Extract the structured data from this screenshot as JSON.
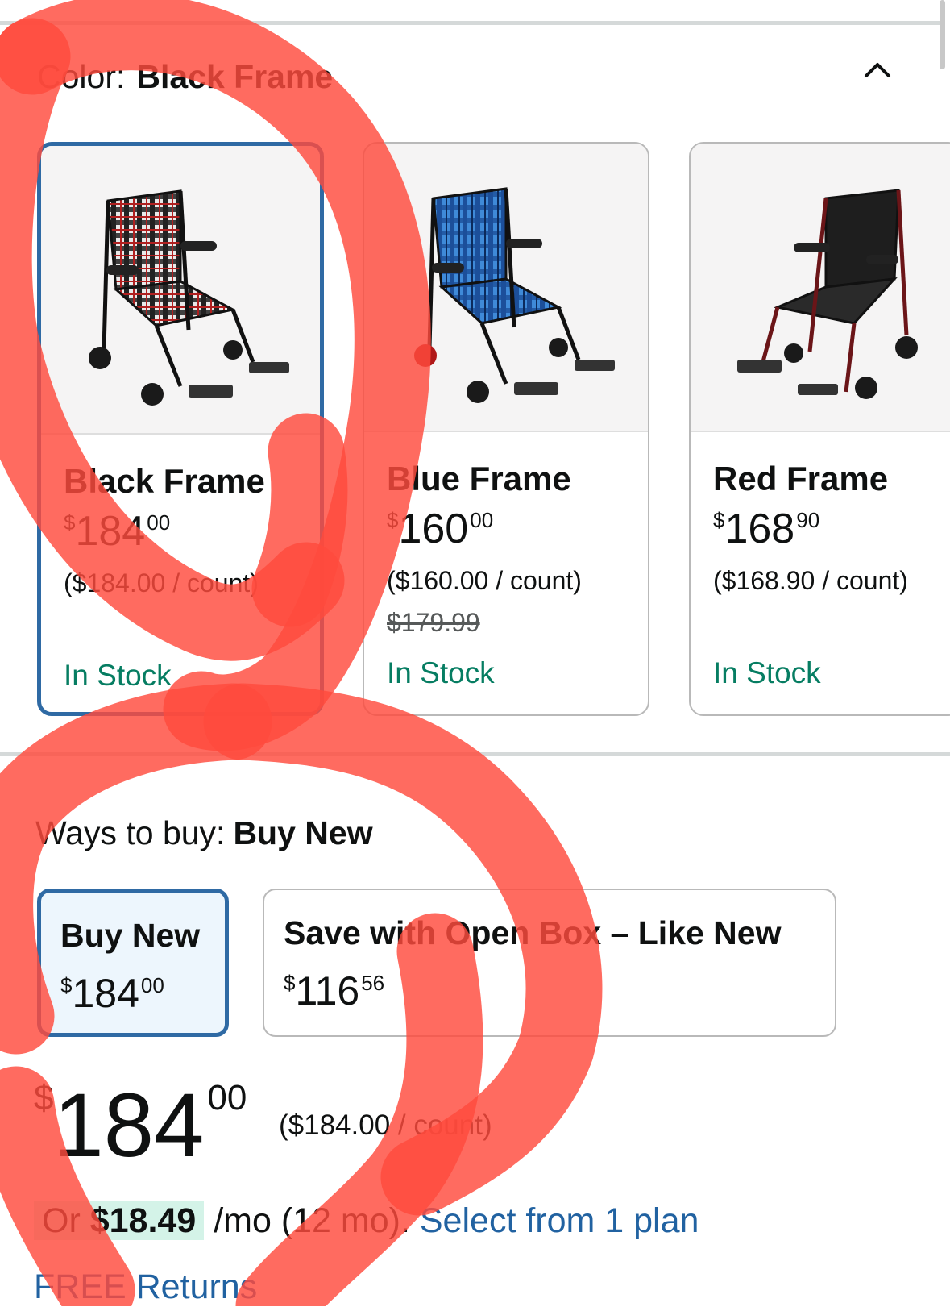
{
  "color": {
    "label": "Color:",
    "value": "Black Frame"
  },
  "variants": [
    {
      "name": "Black Frame",
      "price_symbol": "$",
      "price_whole": "184",
      "price_fraction": "00",
      "unit_price": "($184.00 / count)",
      "list_price": "",
      "stock": "In Stock",
      "selected": true
    },
    {
      "name": "Blue Frame",
      "price_symbol": "$",
      "price_whole": "160",
      "price_fraction": "00",
      "unit_price": "($160.00 / count)",
      "list_price": "$179.99",
      "stock": "In Stock",
      "selected": false
    },
    {
      "name": "Red Frame",
      "price_symbol": "$",
      "price_whole": "168",
      "price_fraction": "90",
      "unit_price": "($168.90 / count)",
      "list_price": "",
      "stock": "In Stock",
      "selected": false
    }
  ],
  "ways_to_buy": {
    "label": "Ways to buy:",
    "value": "Buy New",
    "options": [
      {
        "title": "Buy New",
        "price_symbol": "$",
        "price_whole": "184",
        "price_fraction": "00",
        "selected": true
      },
      {
        "title": "Save with Open Box – Like New",
        "price_symbol": "$",
        "price_whole": "116",
        "price_fraction": "56",
        "selected": false
      }
    ]
  },
  "main_price": {
    "symbol": "$",
    "whole": "184",
    "fraction": "00",
    "unit": "($184.00 / count)"
  },
  "financing": {
    "prefix": "Or ",
    "amount": "$18.49",
    "term": " /mo (12 mo). ",
    "link": "Select from 1 plan"
  },
  "returns": {
    "label": "FREE Returns"
  },
  "colors": {
    "selected_border": "#2f6aa4",
    "in_stock": "#067d62",
    "link": "#2162a1",
    "highlight": "#d4f3e8",
    "annotation": "#ff4a3d"
  },
  "icons": {
    "collapse": "chevron-up-icon"
  }
}
